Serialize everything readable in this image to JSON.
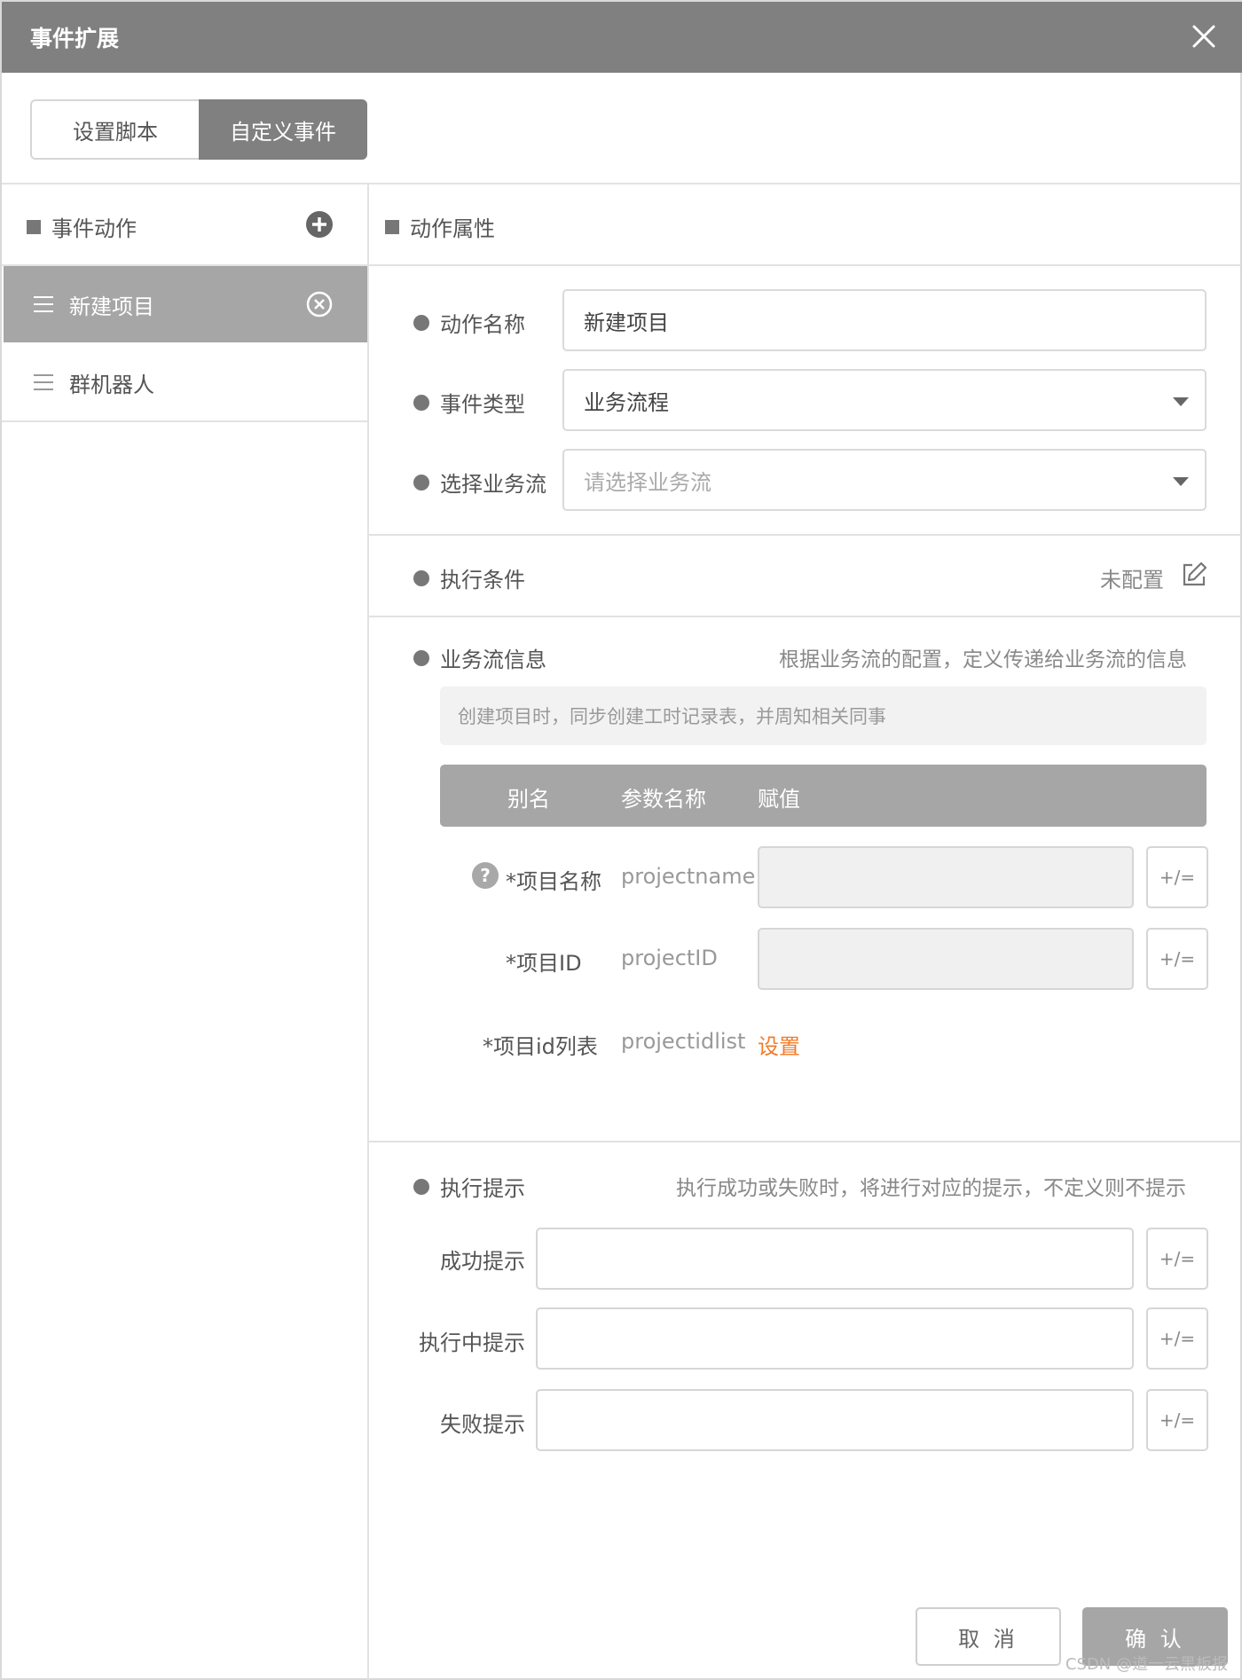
{
  "dialog": {
    "title": "事件扩展"
  },
  "tabs": [
    {
      "label": "设置脚本",
      "active": false
    },
    {
      "label": "自定义事件",
      "active": true
    }
  ],
  "left_panel": {
    "header": "事件动作",
    "items": [
      {
        "label": "新建项目",
        "selected": true
      },
      {
        "label": "群机器人",
        "selected": false
      }
    ]
  },
  "right_panel": {
    "header": "动作属性",
    "action_name": {
      "label": "动作名称",
      "value": "新建项目"
    },
    "event_type": {
      "label": "事件类型",
      "value": "业务流程"
    },
    "business_flow": {
      "label": "选择业务流",
      "placeholder": "请选择业务流"
    },
    "exec_condition": {
      "label": "执行条件",
      "status": "未配置"
    },
    "flow_info": {
      "label": "业务流信息",
      "hint": "根据业务流的配置，定义传递给业务流的信息",
      "note": "创建项目时，同步创建工时记录表，并周知相关同事",
      "columns": [
        "别名",
        "参数名称",
        "赋值"
      ],
      "params": [
        {
          "alias": "*项目名称",
          "name": "projectname",
          "help": "?",
          "expr": "+/="
        },
        {
          "alias": "*项目ID",
          "name": "projectID",
          "expr": "+/="
        },
        {
          "alias": "*项目id列表",
          "name": "projectidlist",
          "link": "设置"
        }
      ]
    },
    "exec_tips": {
      "label": "执行提示",
      "hint": "执行成功或失败时，将进行对应的提示，不定义则不提示",
      "rows": [
        {
          "label": "成功提示",
          "expr": "+/="
        },
        {
          "label": "执行中提示",
          "expr": "+/="
        },
        {
          "label": "失败提示",
          "expr": "+/="
        }
      ]
    }
  },
  "footer": {
    "cancel": "取 消",
    "confirm": "确 认"
  },
  "watermark": "CSDN @道一云黑板报"
}
